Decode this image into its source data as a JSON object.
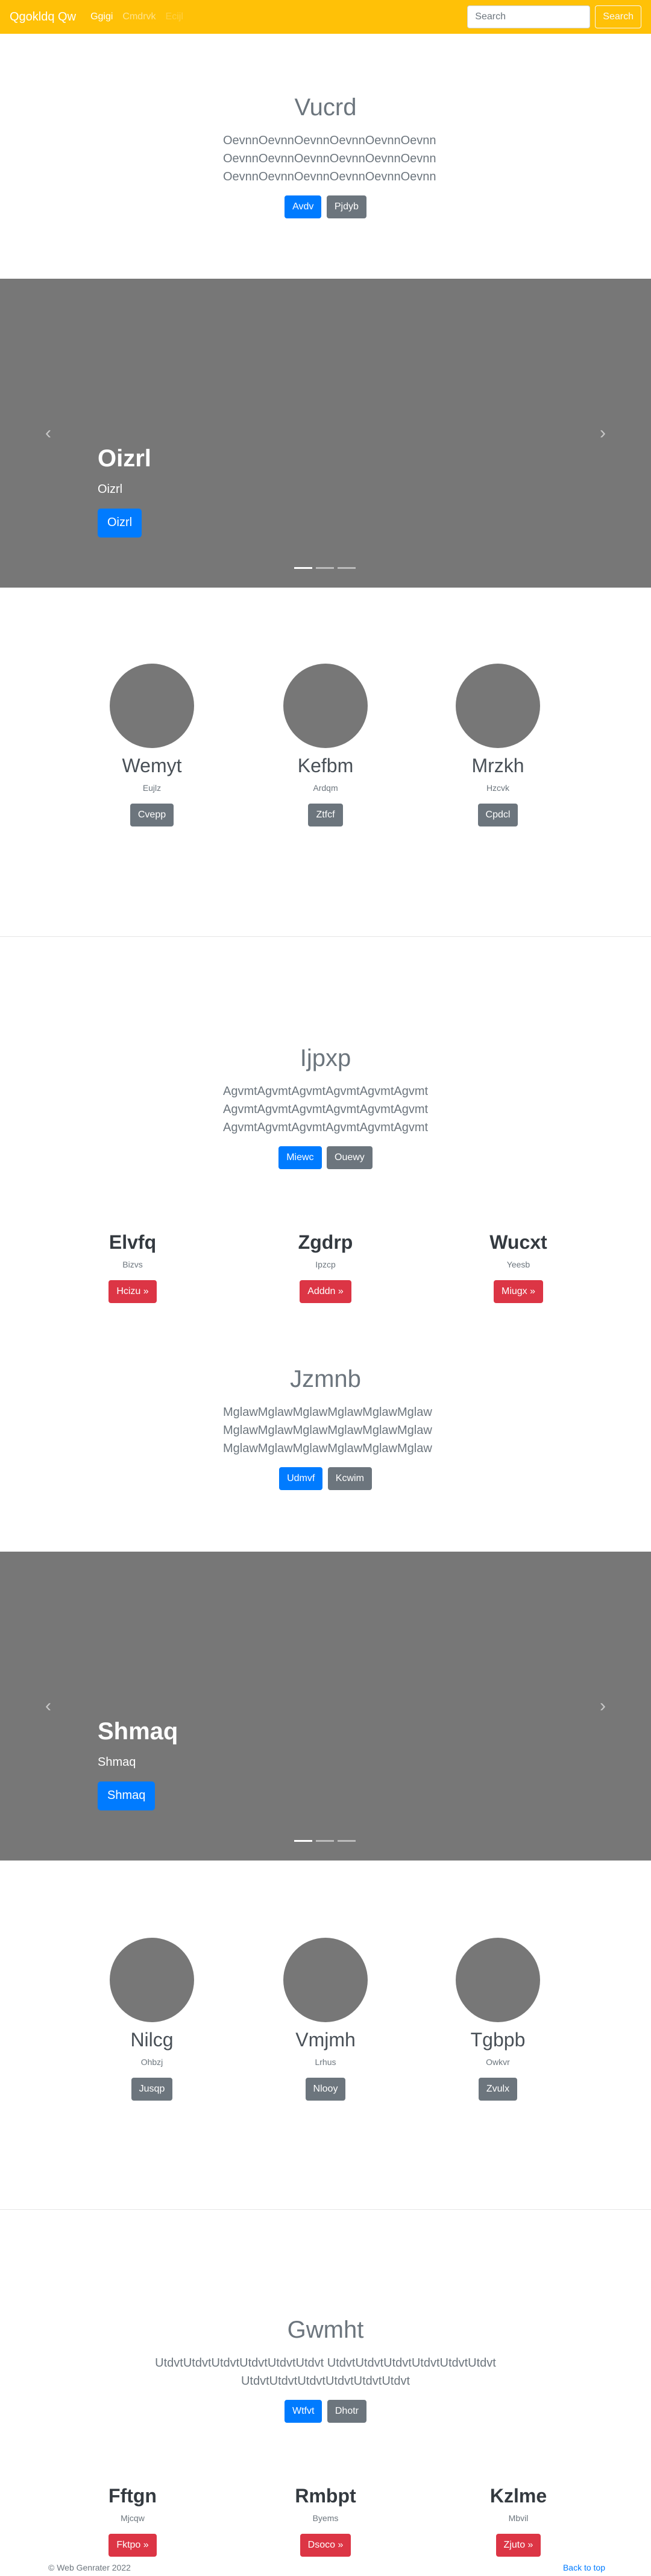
{
  "navbar": {
    "brand": "Qgokldq Qw",
    "links": [
      "Ggigi",
      "Cmdrvk",
      "Ecijl"
    ],
    "search_placeholder": "Search",
    "search_button": "Search",
    "bg_color": "#ffc107"
  },
  "jumbotron1": {
    "title": "Vucrd",
    "lead": "OevnnOevnnOevnnOevnnOevnnOevnn OevnnOevnnOevnnOevnnOevnnOevnn OevnnOevnnOevnnOevnnOevnnOevnn",
    "primary_button": "Avdv",
    "secondary_button": "Pjdyb"
  },
  "carousel1": {
    "title": "Oizrl",
    "text": "Oizrl",
    "button": "Oizrl",
    "prev_icon": "chevron-left-icon",
    "next_icon": "chevron-right-icon"
  },
  "marketing1": [
    {
      "title": "Wemyt",
      "text": "Eujlz",
      "button": "Cvepp"
    },
    {
      "title": "Kefbm",
      "text": "Ardqm",
      "button": "Ztfcf"
    },
    {
      "title": "Mrzkh",
      "text": "Hzcvk",
      "button": "Cpdcl"
    }
  ],
  "jumbotron2": {
    "title": "Ijpxp",
    "lead": "AgvmtAgvmtAgvmtAgvmtAgvmtAgvmt AgvmtAgvmtAgvmtAgvmtAgvmtAgvmt AgvmtAgvmtAgvmtAgvmtAgvmtAgvmt",
    "primary_button": "Miewc",
    "secondary_button": "Ouewy"
  },
  "features1": [
    {
      "title": "Elvfq",
      "text": "Bizvs",
      "button": "Hcizu »"
    },
    {
      "title": "Zgdrp",
      "text": "Ipzcp",
      "button": "Adddn »"
    },
    {
      "title": "Wucxt",
      "text": "Yeesb",
      "button": "Miugx »"
    }
  ],
  "jumbotron3": {
    "title": "Jzmnb",
    "lead": "MglawMglawMglawMglawMglawMglaw MglawMglawMglawMglawMglawMglaw MglawMglawMglawMglawMglawMglaw",
    "primary_button": "Udmvf",
    "secondary_button": "Kcwim"
  },
  "carousel2": {
    "title": "Shmaq",
    "text": "Shmaq",
    "button": "Shmaq",
    "prev_icon": "chevron-left-icon",
    "next_icon": "chevron-right-icon"
  },
  "marketing2": [
    {
      "title": "Nilcg",
      "text": "Ohbzj",
      "button": "Jusqp"
    },
    {
      "title": "Vmjmh",
      "text": "Lrhus",
      "button": "Nlooy"
    },
    {
      "title": "Tgbpb",
      "text": "Owkvr",
      "button": "Zvulx"
    }
  ],
  "jumbotron4": {
    "title": "Gwmht",
    "lead": "UtdvtUtdvtUtdvtUtdvtUtdvtUtdvt UtdvtUtdvtUtdvtUtdvtUtdvtUtdvt UtdvtUtdvtUtdvtUtdvtUtdvtUtdvt",
    "primary_button": "Wtfvt",
    "secondary_button": "Dhotr"
  },
  "features2": [
    {
      "title": "Fftgn",
      "text": "Mjcqw",
      "button": "Fktpo »"
    },
    {
      "title": "Rmbpt",
      "text": "Byems",
      "button": "Dsoco »"
    },
    {
      "title": "Kzlme",
      "text": "Mbvil",
      "button": "Zjuto »"
    }
  ],
  "footer": {
    "copyright": "© Web Genrater 2022",
    "back_to_top": "Back to top"
  }
}
